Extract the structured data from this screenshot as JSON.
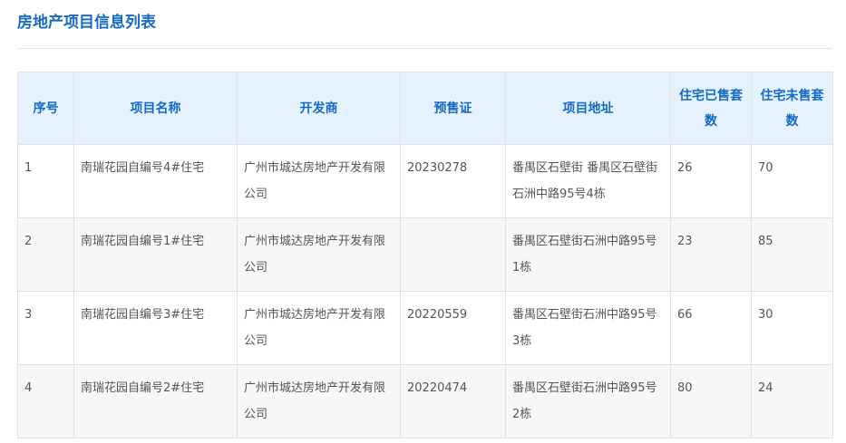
{
  "page": {
    "title": "房地产项目信息列表"
  },
  "table": {
    "headers": [
      "序号",
      "项目名称",
      "开发商",
      "预售证",
      "项目地址",
      "住宅已售套数",
      "住宅未售套数"
    ],
    "rows": [
      [
        "1",
        "南瑞花园自编号4#住宅",
        "广州市城达房地产开发有限公司",
        "20230278",
        "番禺区石壁街 番禺区石壁街石洲中路95号4栋",
        "26",
        "70"
      ],
      [
        "2",
        "南瑞花园自编号1#住宅",
        "广州市城达房地产开发有限公司",
        "",
        "番禺区石壁街石洲中路95号1栋",
        "23",
        "85"
      ],
      [
        "3",
        "南瑞花园自编号3#住宅",
        "广州市城达房地产开发有限公司",
        "20220559",
        "番禺区石壁街石洲中路95号3栋",
        "66",
        "30"
      ],
      [
        "4",
        "南瑞花园自编号2#住宅",
        "广州市城达房地产开发有限公司",
        "20220474",
        "番禺区石壁街石洲中路95号2栋",
        "80",
        "24"
      ]
    ]
  }
}
